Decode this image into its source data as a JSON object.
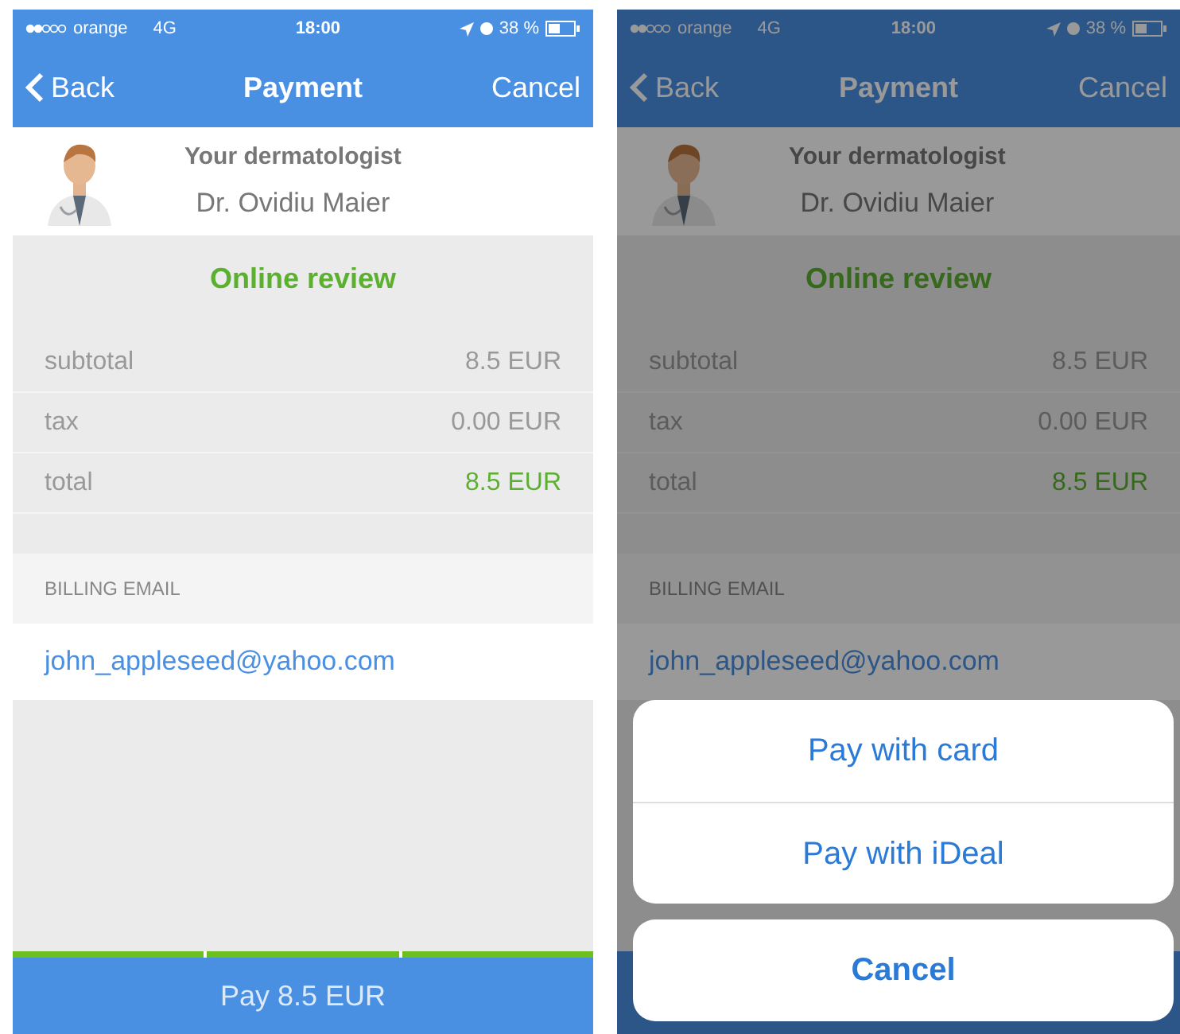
{
  "screens": [
    {
      "dimmed": false,
      "status_bar": {
        "carrier": "orange",
        "network": "4G",
        "time": "18:00",
        "battery": "38 %"
      },
      "nav": {
        "back": "Back",
        "title": "Payment",
        "cancel": "Cancel"
      },
      "doctor": {
        "role": "Your dermatologist",
        "name": "Dr. Ovidiu Maier"
      },
      "summary": {
        "title": "Online review",
        "rows": [
          {
            "label": "subtotal",
            "value": "8.5 EUR",
            "highlight": false
          },
          {
            "label": "tax",
            "value": "0.00 EUR",
            "highlight": false
          },
          {
            "label": "total",
            "value": "8.5 EUR",
            "highlight": true
          }
        ]
      },
      "billing": {
        "label": "BILLING EMAIL",
        "email": "john_appleseed@yahoo.com"
      },
      "steps": [
        {
          "done": true
        },
        {
          "done": true
        },
        {
          "done": true
        }
      ],
      "pay_button": "Pay 8.5 EUR"
    },
    {
      "dimmed": true,
      "status_bar": {
        "carrier": "orange",
        "network": "4G",
        "time": "18:00",
        "battery": "38 %"
      },
      "nav": {
        "back": "Back",
        "title": "Payment",
        "cancel": "Cancel"
      },
      "doctor": {
        "role": "Your dermatologist",
        "name": "Dr. Ovidiu Maier"
      },
      "summary": {
        "title": "Online review",
        "rows": [
          {
            "label": "subtotal",
            "value": "8.5 EUR",
            "highlight": false
          },
          {
            "label": "tax",
            "value": "0.00 EUR",
            "highlight": false
          },
          {
            "label": "total",
            "value": "8.5 EUR",
            "highlight": true
          }
        ]
      },
      "billing": {
        "label": "BILLING EMAIL",
        "email": "john_appleseed@yahoo.com"
      },
      "action_sheet": {
        "options": [
          "Pay with card",
          "Pay with iDeal"
        ],
        "cancel": "Cancel"
      }
    }
  ]
}
